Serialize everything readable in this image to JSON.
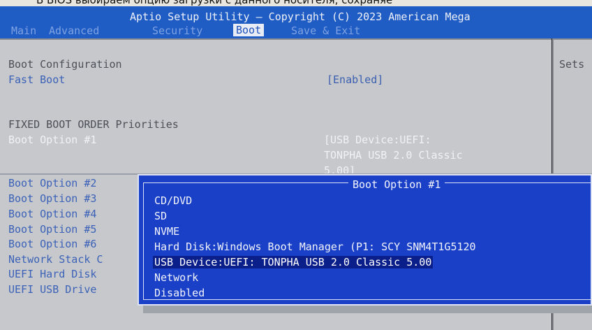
{
  "caption_strip": "В BIOS выбираем опцию загрузки с данного носителя, сохраняе",
  "header": {
    "title": "Aptio Setup Utility – Copyright (C) 2023 American Mega"
  },
  "tabs": [
    {
      "label": "Main"
    },
    {
      "label": "Advanced"
    },
    {
      "label": "Security"
    },
    {
      "label": "Boot"
    },
    {
      "label": "Save & Exit"
    }
  ],
  "main": {
    "section_title": "Boot Configuration",
    "fast_boot": {
      "label": "Fast Boot",
      "value": "[Enabled]"
    },
    "fixed_order_title": "FIXED BOOT ORDER Priorities",
    "boot_option_1": {
      "label": "Boot Option #1",
      "value_lines": [
        "[USB Device:UEFI:",
        "TONPHA USB 2.0 Classic",
        "5.00]"
      ]
    },
    "boot_options": [
      {
        "label": "Boot Option #2"
      },
      {
        "label": "Boot Option #3"
      },
      {
        "label": "Boot Option #4"
      },
      {
        "label": "Boot Option #5"
      },
      {
        "label": "Boot Option #6"
      },
      {
        "label": "Network Stack C"
      },
      {
        "label": "UEFI Hard Disk"
      },
      {
        "label": "UEFI USB Drive"
      }
    ]
  },
  "side_help": {
    "text": "Sets"
  },
  "popup": {
    "title": "Boot Option #1",
    "options": [
      {
        "label": "CD/DVD"
      },
      {
        "label": "SD"
      },
      {
        "label": "NVME"
      },
      {
        "label": "Hard Disk:Windows Boot Manager (P1: SCY SNM4T1G5120"
      },
      {
        "label": "USB Device:UEFI: TONPHA USB 2.0 Classic 5.00"
      },
      {
        "label": "Network"
      },
      {
        "label": "Disabled"
      }
    ],
    "selected_index": 4
  },
  "colors": {
    "title_bar": "#1f5cc4",
    "panel_bg": "#c7c8cb",
    "popup_bg": "#1a40c8",
    "selection_bg": "#0b1f8a",
    "highlight_text": "#3a5fb0"
  }
}
